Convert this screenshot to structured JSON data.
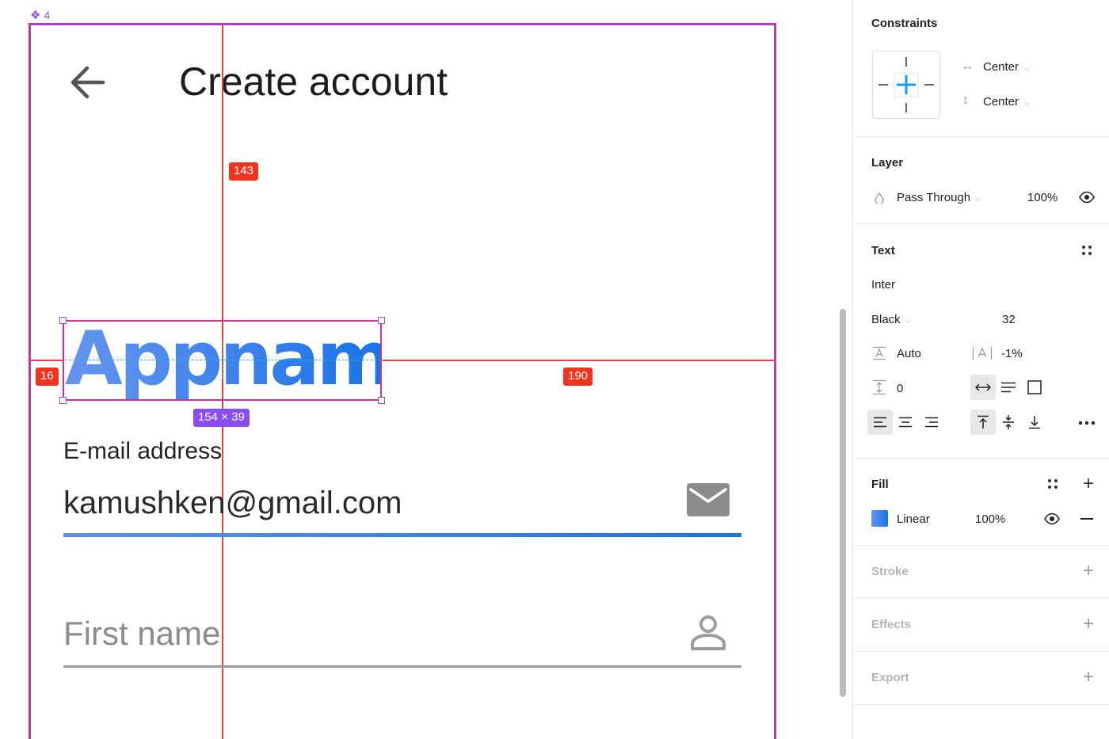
{
  "canvas": {
    "frame_label": "4",
    "app": {
      "title": "Create account",
      "appname": "Appname",
      "email_label": "E-mail address",
      "email_value": "kamushken@gmail.com",
      "firstname_placeholder": "First name"
    },
    "measurements": {
      "top": "143",
      "left": "16",
      "right": "190",
      "size": "154 × 39"
    }
  },
  "panel": {
    "constraints": {
      "title": "Constraints",
      "horizontal": "Center",
      "vertical": "Center"
    },
    "layer": {
      "title": "Layer",
      "blend": "Pass Through",
      "opacity": "100%"
    },
    "text": {
      "title": "Text",
      "font_family": "Inter",
      "font_weight": "Black",
      "font_size": "32",
      "line_height": "Auto",
      "letter_spacing": "-1%",
      "paragraph_spacing": "0"
    },
    "fill": {
      "title": "Fill",
      "type": "Linear",
      "opacity": "100%"
    },
    "stroke": {
      "title": "Stroke"
    },
    "effects": {
      "title": "Effects"
    },
    "export": {
      "title": "Export"
    }
  },
  "colors": {
    "accent_blue": "#1a73e8",
    "gradient_start": "#6694ef",
    "measure_red": "#f2341f",
    "selection_purple": "#8a4df2",
    "frame_magenta": "#c8329b"
  }
}
